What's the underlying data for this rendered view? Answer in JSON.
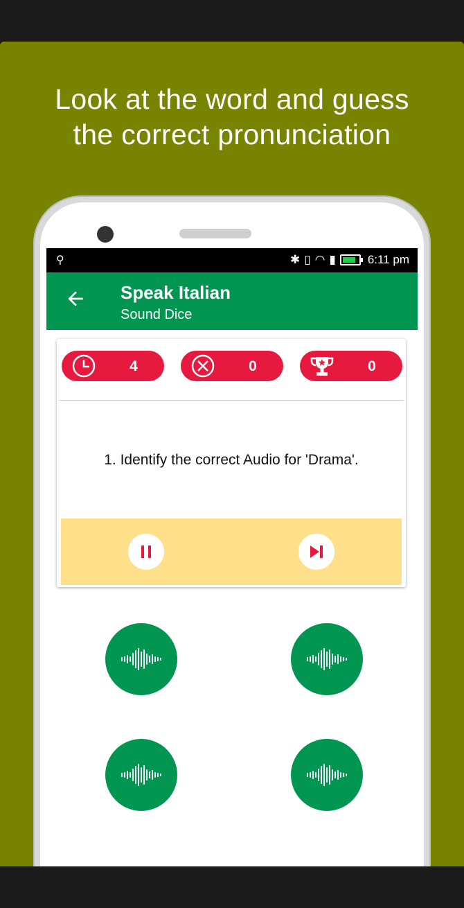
{
  "promo": {
    "caption_line1": "Look at the word and guess",
    "caption_line2": "the correct pronunciation"
  },
  "statusbar": {
    "time": "6:11 pm"
  },
  "appbar": {
    "title": "Speak Italian",
    "subtitle": "Sound Dice"
  },
  "stats": [
    {
      "icon": "clock-icon",
      "value": "4"
    },
    {
      "icon": "wrong-circle-icon",
      "value": "0"
    },
    {
      "icon": "trophy-icon",
      "value": "0"
    }
  ],
  "question": {
    "text": "1. Identify the correct Audio for 'Drama'."
  },
  "controls": [
    {
      "icon": "pause-icon"
    },
    {
      "icon": "skip-next-icon"
    }
  ],
  "answers": [
    {
      "icon": "audio-wave-icon"
    },
    {
      "icon": "audio-wave-icon"
    },
    {
      "icon": "audio-wave-icon"
    },
    {
      "icon": "audio-wave-icon"
    }
  ],
  "colors": {
    "background": "#788300",
    "appbar": "#009551",
    "stat_pill": "#e51a3e",
    "controls_bg": "#ffe08a",
    "answer_button": "#009551"
  }
}
